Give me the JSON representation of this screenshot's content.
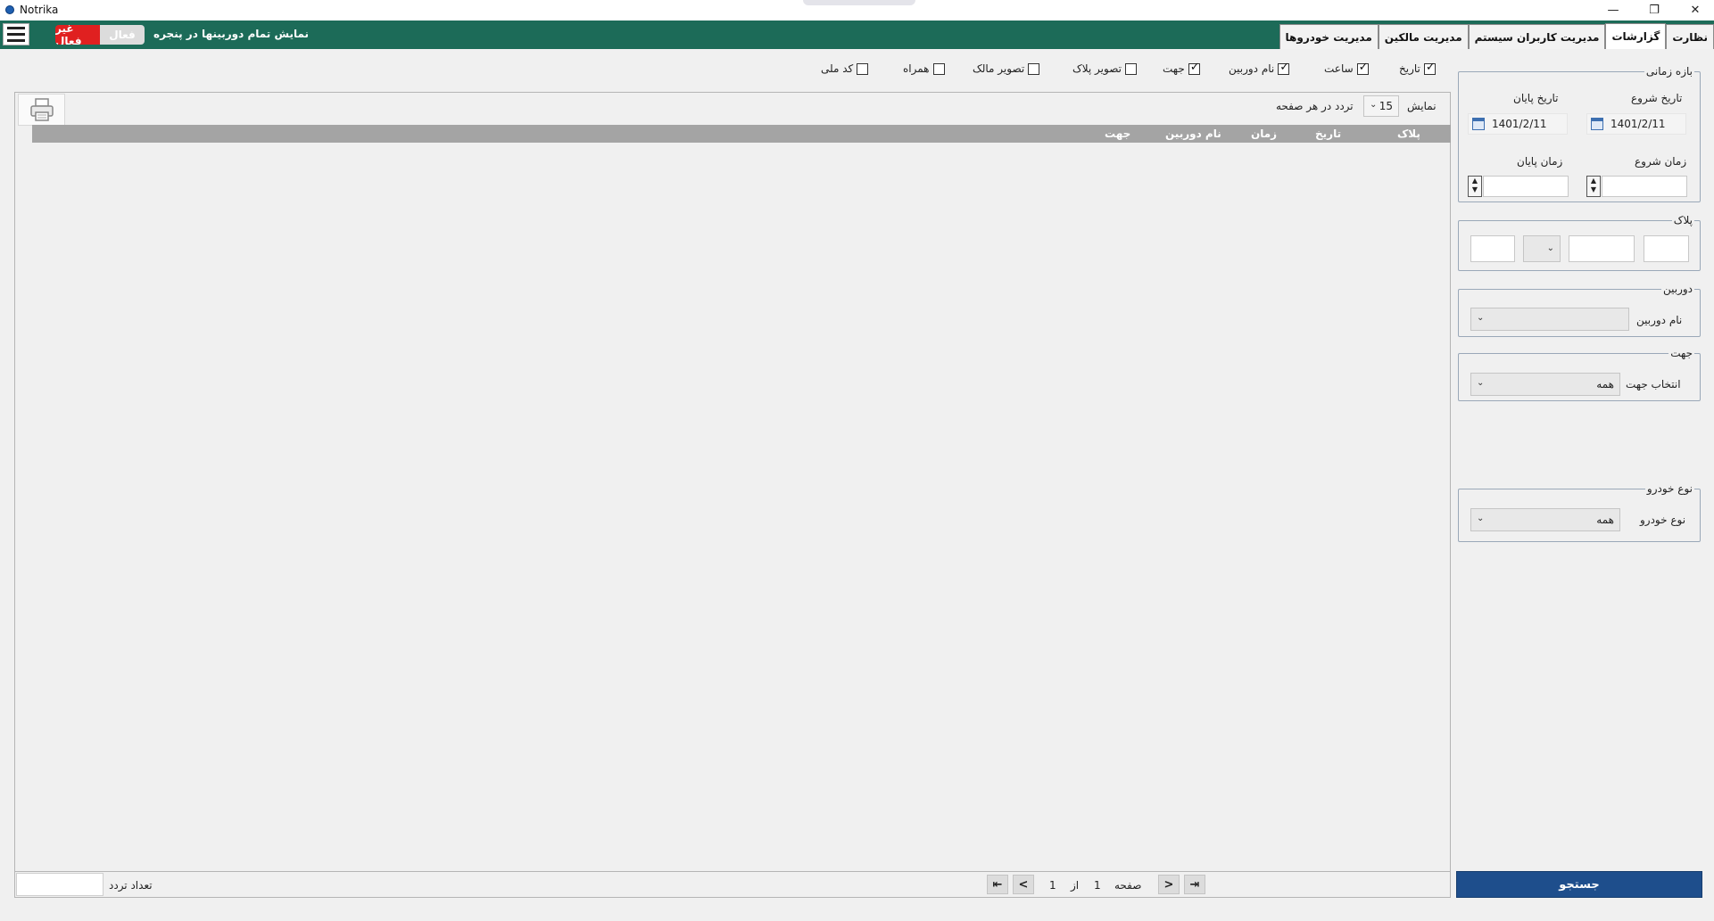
{
  "window": {
    "title": "Notrika",
    "minimize_symbol": "—",
    "maximize_symbol": "❐",
    "close_symbol": "✕"
  },
  "topbar": {
    "toggle_inactive": "غیر فعال",
    "toggle_active": "فعال",
    "show_all_cameras": "نمایش تمام دوربینها در پنجره",
    "accent_color": "#1c6b58",
    "inactive_color": "#e02020"
  },
  "tabs": [
    {
      "label": "مدیریت خودروها",
      "selected": false
    },
    {
      "label": "مدیریت مالکین",
      "selected": false
    },
    {
      "label": "مدیریت کاربران سیستم",
      "selected": false
    },
    {
      "label": "گزارشات",
      "selected": true
    },
    {
      "label": "نظارت",
      "selected": false
    }
  ],
  "filters": {
    "time_range": {
      "title": "بازه زمانی",
      "start_date_label": "تاریخ شروع",
      "end_date_label": "تاریخ پایان",
      "start_date": "1401/2/11",
      "end_date": "1401/2/11",
      "start_time_label": "زمان شروع",
      "end_time_label": "زمان پایان",
      "start_time": "",
      "end_time": ""
    },
    "plate": {
      "title": "پلاک"
    },
    "camera": {
      "title": "دوربین",
      "name_label": "نام دوربین",
      "selected": ""
    },
    "direction": {
      "title": "جهت",
      "select_label": "انتخاب جهت",
      "selected": "همه"
    },
    "vehicle_type": {
      "title": "نوع خودرو",
      "type_label": "نوع خودرو",
      "selected": "همه"
    },
    "search_button": "جستجو",
    "search_color": "#1e4e8c"
  },
  "columns_checkboxes": [
    {
      "label": "تاریخ",
      "checked": true
    },
    {
      "label": "ساعت",
      "checked": true
    },
    {
      "label": "نام دوربین",
      "checked": true
    },
    {
      "label": "جهت",
      "checked": true
    },
    {
      "label": "تصویر پلاک",
      "checked": false
    },
    {
      "label": "تصویر مالک",
      "checked": false
    },
    {
      "label": "همراه",
      "checked": false
    },
    {
      "label": "کد ملی",
      "checked": false
    }
  ],
  "grid": {
    "show_label": "نمایش",
    "page_size": "15",
    "per_page_label": "تردد در هر صفحه",
    "headers": [
      "پلاک",
      "تاریخ",
      "زمان",
      "نام دوربین",
      "جهت"
    ]
  },
  "pager": {
    "page_label": "صفحه",
    "current_page": "1",
    "of_label": "از",
    "total_pages": "1",
    "count_label": "تعداد تردد"
  }
}
